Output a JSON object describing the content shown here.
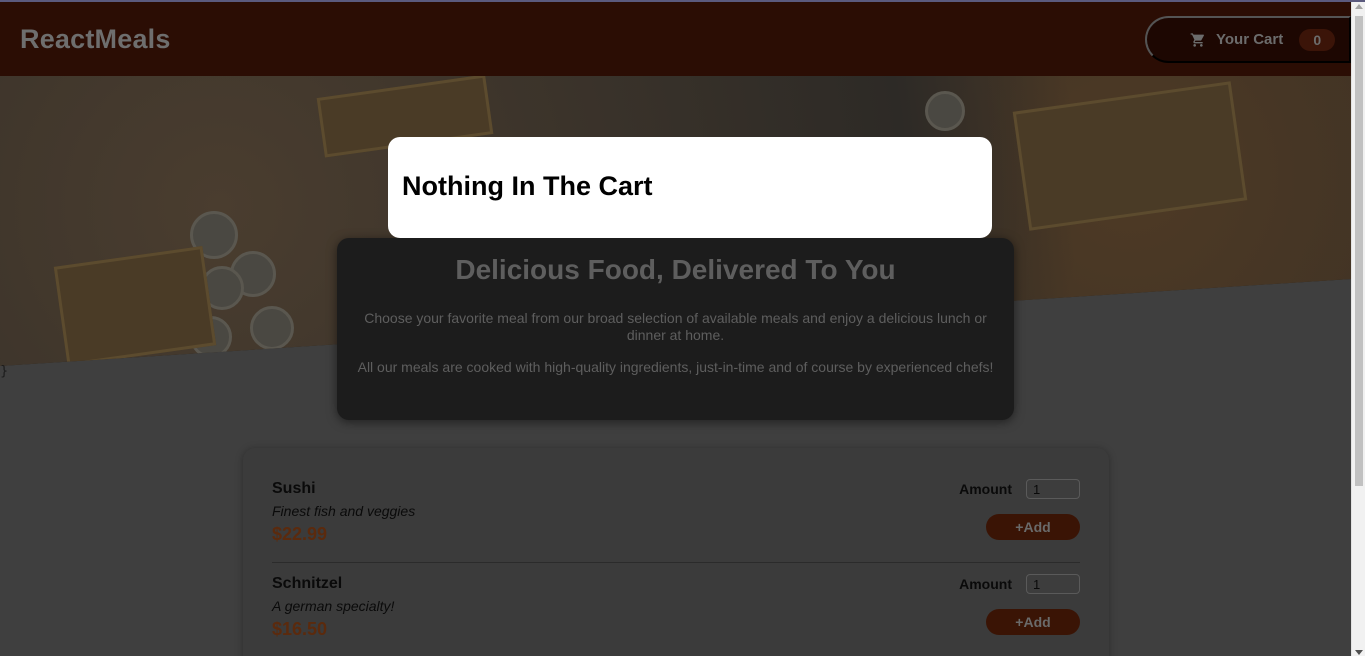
{
  "header": {
    "brand": "ReactMeals",
    "cart": {
      "label": "Your Cart",
      "count": "0",
      "icon": "cart-icon"
    }
  },
  "stray_text": "}",
  "summary": {
    "title": "Delicious Food, Delivered To You",
    "paragraph1": "Choose your favorite meal from our broad selection of available meals and enjoy a delicious lunch or dinner at home.",
    "paragraph2": "All our meals are cooked with high-quality ingredients, just-in-time and of course by experienced chefs!"
  },
  "meals": [
    {
      "name": "Sushi",
      "description": "Finest fish and veggies",
      "price": "$22.99",
      "amount_label": "Amount",
      "amount_value": "1",
      "add_label": "+Add"
    },
    {
      "name": "Schnitzel",
      "description": "A german specialty!",
      "price": "$16.50",
      "amount_label": "Amount",
      "amount_value": "1",
      "add_label": "+Add"
    }
  ],
  "modal": {
    "title": "Nothing In The Cart"
  },
  "colors": {
    "header": "#2b0d04",
    "accent": "#5b2a0d",
    "modal": "#ffffff"
  }
}
